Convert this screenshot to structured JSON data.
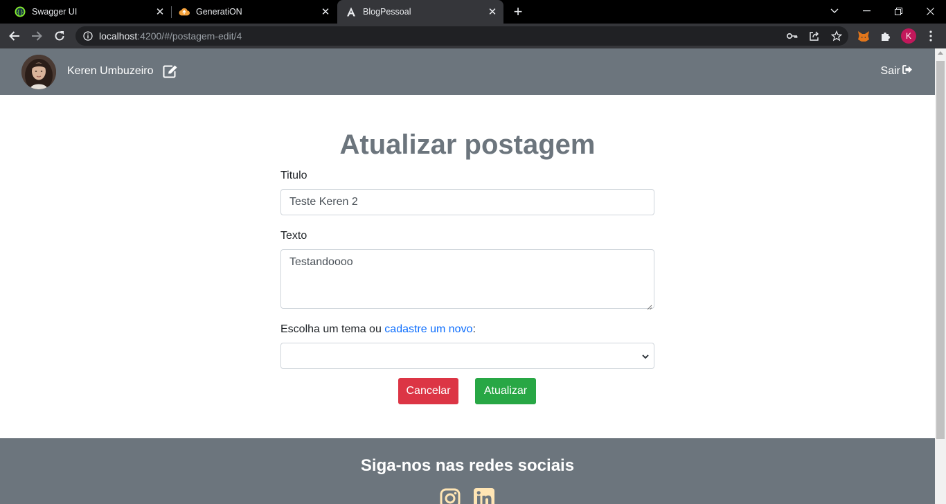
{
  "browser": {
    "tabs": [
      {
        "title": "Swagger UI",
        "icon": "swagger-icon",
        "active": false
      },
      {
        "title": "GeneratiON",
        "icon": "cloud-icon",
        "active": false
      },
      {
        "title": "BlogPessoal",
        "icon": "angular-icon",
        "active": true
      }
    ],
    "address": {
      "host": "localhost",
      "path": ":4200/#/postagem-edit/4"
    },
    "profile_initial": "K"
  },
  "header": {
    "user_name": "Keren Umbuzeiro",
    "logout_label": "Sair"
  },
  "main": {
    "title": "Atualizar postagem",
    "fields": {
      "titulo_label": "Titulo",
      "titulo_value": "Teste Keren 2",
      "texto_label": "Texto",
      "texto_value": "Testandoooo",
      "tema_label_prefix": "Escolha um tema ou ",
      "tema_link": "cadastre um novo",
      "tema_label_suffix": ":",
      "tema_selected": ""
    },
    "buttons": {
      "cancel": "Cancelar",
      "update": "Atualizar"
    }
  },
  "footer": {
    "title": "Siga-nos nas redes sociais",
    "social_icons": [
      "instagram-icon",
      "linkedin-icon"
    ]
  },
  "colors": {
    "nav_bg": "#6c757d",
    "cancel": "#dc3545",
    "update": "#28a745",
    "link": "#0d6efd",
    "social_icon": "#ffe5b4"
  }
}
